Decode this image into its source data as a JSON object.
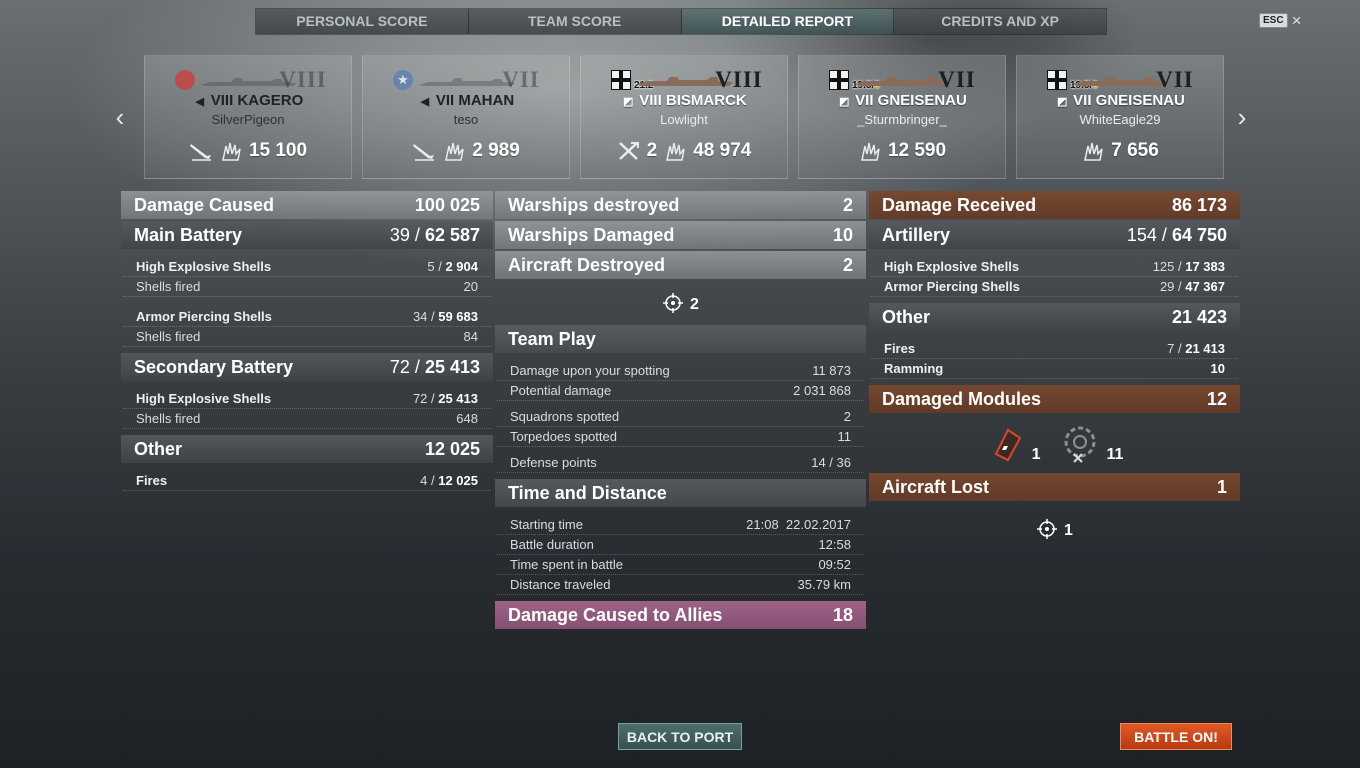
{
  "tabs": [
    {
      "label": "PERSONAL SCORE"
    },
    {
      "label": "TEAM SCORE"
    },
    {
      "label": "DETAILED REPORT"
    },
    {
      "label": "CREDITS AND XP"
    }
  ],
  "esc": {
    "key": "ESC",
    "close": "×"
  },
  "nav": {
    "prev": "‹",
    "next": "›"
  },
  "ships": [
    {
      "tier": "VIII",
      "name": "VIII KAGERO",
      "player": "SilverPigeon",
      "value": "15 100",
      "extra": ""
    },
    {
      "tier": "VII",
      "name": "VII MAHAN",
      "player": "teso",
      "value": "2 989",
      "extra": ""
    },
    {
      "tier": "VIII",
      "name": "VIII BISMARCK",
      "player": "Lowlight",
      "value": "48 974",
      "extra": "2",
      "badge": "21.2"
    },
    {
      "tier": "VII",
      "name": "VII GNEISENAU",
      "player": "_Sturmbringer_",
      "value": "12 590",
      "badge_main": "19.5/",
      "badge_y": "6"
    },
    {
      "tier": "VII",
      "name": "VII GNEISENAU",
      "player": "WhiteEagle29",
      "value": "7 656",
      "badge_main": "19.5/",
      "badge_y": "6"
    }
  ],
  "left": {
    "damage_caused": {
      "label": "Damage Caused",
      "value": "100 025"
    },
    "main_battery": {
      "label": "Main Battery",
      "hits": "39 / ",
      "value": "62 587"
    },
    "he": {
      "label": "High Explosive Shells",
      "hits": "5 / ",
      "value": "2 904"
    },
    "he_fired": {
      "label": "Shells fired",
      "value": "20"
    },
    "ap": {
      "label": "Armor Piercing Shells",
      "hits": "34 / ",
      "value": "59 683"
    },
    "ap_fired": {
      "label": "Shells fired",
      "value": "84"
    },
    "secondary": {
      "label": "Secondary Battery",
      "hits": "72 / ",
      "value": "25 413"
    },
    "sec_he": {
      "label": "High Explosive Shells",
      "hits": "72 / ",
      "value": "25 413"
    },
    "sec_fired": {
      "label": "Shells fired",
      "value": "648"
    },
    "other": {
      "label": "Other",
      "value": "12 025"
    },
    "fires": {
      "label": "Fires",
      "hits": "4 / ",
      "value": "12 025"
    }
  },
  "middle": {
    "warships_destroyed": {
      "label": "Warships destroyed",
      "value": "2"
    },
    "warships_damaged": {
      "label": "Warships Damaged",
      "value": "10"
    },
    "aircraft_destroyed": {
      "label": "Aircraft Destroyed",
      "value": "2"
    },
    "aircraft_icon_count": "2",
    "team_play": {
      "label": "Team Play"
    },
    "spotting": {
      "label": "Damage upon your spotting",
      "value": "11 873"
    },
    "potential": {
      "label": "Potential damage",
      "value": "2 031 868"
    },
    "squadrons": {
      "label": "Squadrons spotted",
      "value": "2"
    },
    "torpedoes": {
      "label": "Torpedoes spotted",
      "value": "11"
    },
    "defense": {
      "label": "Defense points",
      "value": "14 / 36"
    },
    "time_distance": {
      "label": "Time and Distance"
    },
    "start": {
      "label": "Starting time",
      "value": "21:08  22.02.2017"
    },
    "duration": {
      "label": "Battle duration",
      "value": "12:58"
    },
    "time_spent": {
      "label": "Time spent in battle",
      "value": "09:52"
    },
    "distance": {
      "label": "Distance traveled",
      "value": "35.79 km"
    },
    "allies": {
      "label": "Damage Caused to Allies",
      "value": "18"
    }
  },
  "right": {
    "damage_received": {
      "label": "Damage Received",
      "value": "86 173"
    },
    "artillery": {
      "label": "Artillery",
      "hits": "154 / ",
      "value": "64 750"
    },
    "he": {
      "label": "High Explosive Shells",
      "hits": "125 / ",
      "value": "17 383"
    },
    "ap": {
      "label": "Armor Piercing Shells",
      "hits": "29 / ",
      "value": "47 367"
    },
    "other": {
      "label": "Other",
      "value": "21 423"
    },
    "fires": {
      "label": "Fires",
      "hits": "7 / ",
      "value": "21 413"
    },
    "ramming": {
      "label": "Ramming",
      "value": "10"
    },
    "modules": {
      "label": "Damaged Modules",
      "value": "12"
    },
    "module_a": "1",
    "module_b": "11",
    "aircraft_lost": {
      "label": "Aircraft Lost",
      "value": "1"
    },
    "aircraft_icon_count": "1"
  },
  "buttons": {
    "back": "BACK TO PORT",
    "battle": "BATTLE ON!"
  },
  "colors": {
    "accent_teal": "#4e6e70",
    "battle_orange": "#e25a26",
    "received_brown": "#784830",
    "allies_pink": "#a4668c"
  }
}
